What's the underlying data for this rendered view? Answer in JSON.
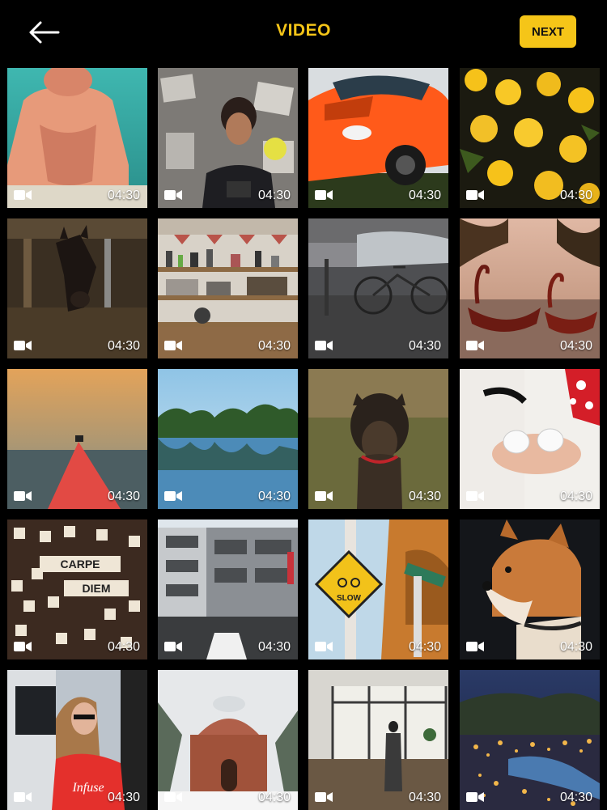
{
  "header": {
    "title": "VIDEO",
    "next_label": "NEXT",
    "back_icon": "arrow-left-icon",
    "accent_color": "#f5c518"
  },
  "videos": [
    {
      "subject": "swimmer",
      "duration": "04:30"
    },
    {
      "subject": "photographer",
      "duration": "04:30"
    },
    {
      "subject": "red-car",
      "duration": "04:30"
    },
    {
      "subject": "yellow-flowers",
      "duration": "04:30"
    },
    {
      "subject": "horse",
      "duration": "04:30"
    },
    {
      "subject": "kitchen-shelves",
      "duration": "04:30"
    },
    {
      "subject": "bicycles",
      "duration": "04:30"
    },
    {
      "subject": "swan-boats",
      "duration": "04:30"
    },
    {
      "subject": "boat-bow",
      "duration": "04:30"
    },
    {
      "subject": "lake-reflection",
      "duration": "04:30"
    },
    {
      "subject": "puppy",
      "duration": "04:30"
    },
    {
      "subject": "baby-shoes",
      "duration": "04:30"
    },
    {
      "subject": "letter-tiles",
      "duration": "04:30",
      "tile_words": [
        "CARPE",
        "DIEM"
      ]
    },
    {
      "subject": "apartment-building",
      "duration": "04:30"
    },
    {
      "subject": "bike-sign",
      "duration": "04:30",
      "sign_text": "SLOW"
    },
    {
      "subject": "shiba-dog",
      "duration": "04:30"
    },
    {
      "subject": "woman-red-shirt",
      "duration": "04:30",
      "shirt_text": "Infuse"
    },
    {
      "subject": "snowy-building",
      "duration": "04:30"
    },
    {
      "subject": "studio-interior",
      "duration": "04:30"
    },
    {
      "subject": "night-town",
      "duration": "04:30"
    }
  ]
}
